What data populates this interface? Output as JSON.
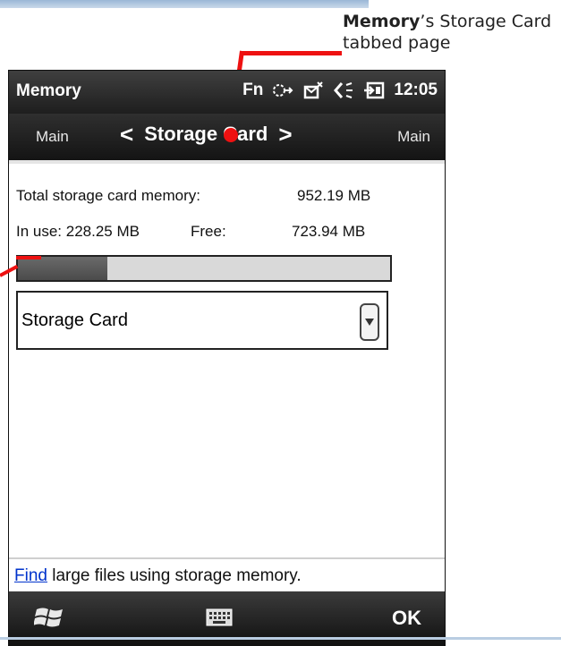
{
  "annotations": {
    "callout_bold": "Memory",
    "callout_rest": "’s Storage Card tabbed page"
  },
  "status_bar": {
    "app_title": "Memory",
    "fn_label": "Fn",
    "time": "12:05",
    "icons": [
      "connectivity-icon",
      "messaging-icon",
      "volume-icon",
      "battery-icon"
    ]
  },
  "tabs": {
    "left": "Main",
    "current": "Storage Card",
    "right": "Main"
  },
  "storage": {
    "total_label": "Total storage card memory:",
    "total_value": "952.19 MB",
    "in_use_label": "In use: 228.25 MB",
    "free_label": "Free:",
    "free_value": "723.94 MB",
    "usage_fraction": 0.24
  },
  "dropdown": {
    "selected": "Storage Card"
  },
  "footer": {
    "link_text": "Find",
    "text_rest": " large files using storage memory."
  },
  "softkeys": {
    "right_label": "OK",
    "icons": [
      "windows-start-icon",
      "keyboard-icon"
    ]
  },
  "colors": {
    "callout": "#ee1111",
    "link": "#0033cc",
    "progress_fill": "#555555"
  }
}
